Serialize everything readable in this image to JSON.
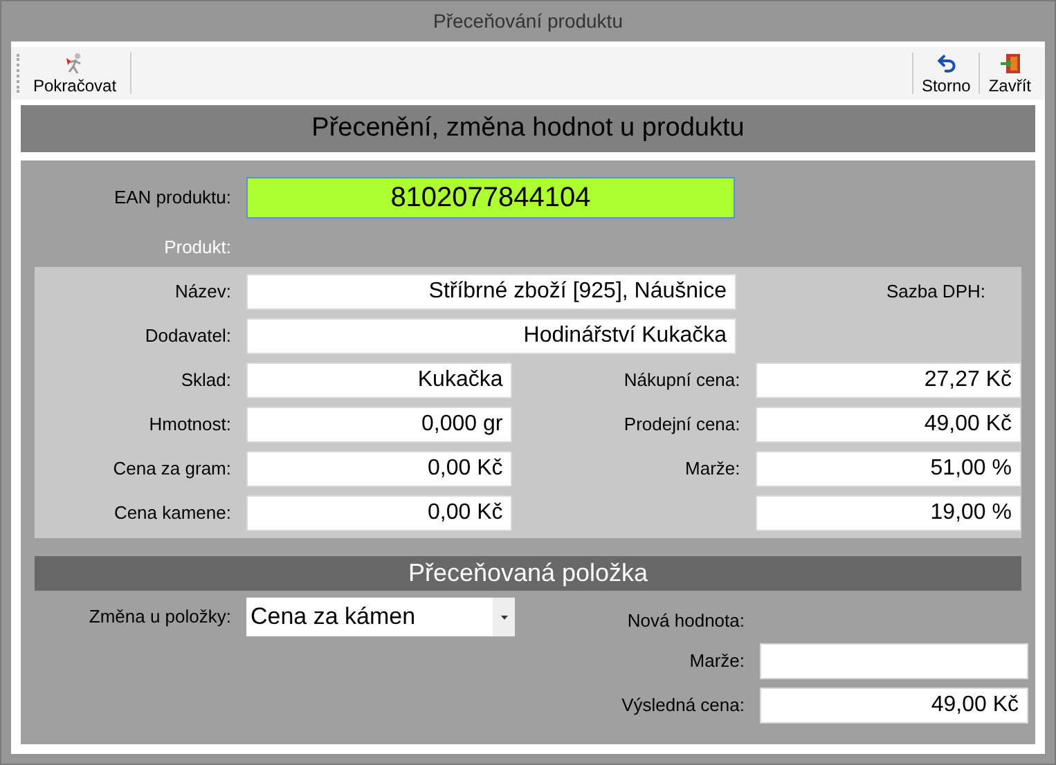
{
  "window": {
    "title": "Přeceňování produktu"
  },
  "toolbar": {
    "left": [
      {
        "kind": "continue",
        "label": "Pokračovat"
      }
    ],
    "right": [
      {
        "kind": "undo",
        "label": "Storno"
      },
      {
        "kind": "exit",
        "label": "Zavřít"
      }
    ]
  },
  "header": "Přecenění, změna hodnot u produktu",
  "ean": {
    "label": "EAN produktu:",
    "value": "8102077844104"
  },
  "product_label": "Produkt:",
  "name": {
    "label": "Název:",
    "value": "Stříbrné zboží [925], Náušnice"
  },
  "vat_label": "Sazba DPH:",
  "supplier": {
    "label": "Dodavatel:",
    "value": "Hodinářství Kukačka"
  },
  "rows": [
    {
      "left": {
        "label": "Sklad:",
        "value": "Kukačka"
      },
      "right": {
        "label": "Nákupní cena:",
        "value": "27,27 Kč"
      }
    },
    {
      "left": {
        "label": "Hmotnost:",
        "value": "0,000 gr"
      },
      "right": {
        "label": "Prodejní cena:",
        "value": "49,00 Kč"
      }
    },
    {
      "left": {
        "label": "Cena za gram:",
        "value": "0,00 Kč"
      },
      "right": {
        "label": "Marže:",
        "value": "51,00 %"
      }
    },
    {
      "left": {
        "label": "Cena kamene:",
        "value": "0,00 Kč"
      },
      "right": {
        "value": "19,00 %"
      }
    }
  ],
  "repricing": {
    "title": "Přeceňovaná položka",
    "change_label": "Změna u položky:",
    "change_value": "Cena za kámen",
    "new_value_label": "Nová hodnota:",
    "margin": {
      "label": "Marže:"
    },
    "result": {
      "label": "Výsledná cena:",
      "value": "49,00 Kč"
    }
  }
}
